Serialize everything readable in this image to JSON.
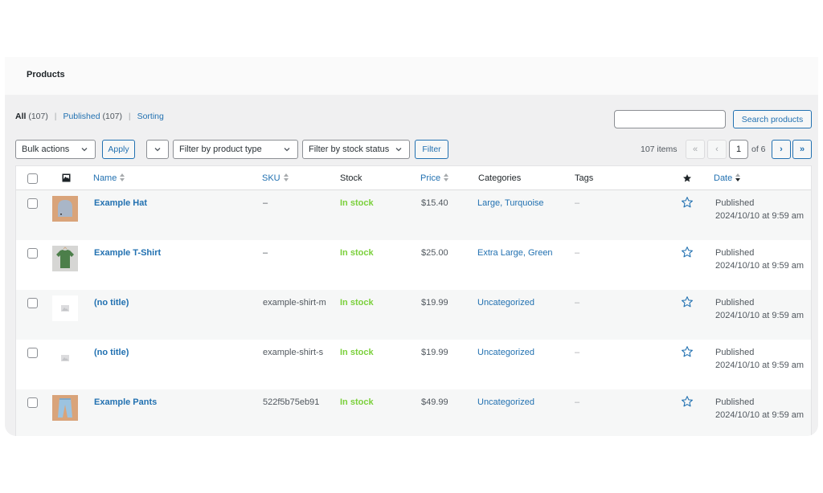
{
  "page": {
    "title": "Products"
  },
  "views": {
    "all_label": "All",
    "all_count": "(107)",
    "published_label": "Published",
    "published_count": "(107)",
    "sorting_label": "Sorting",
    "separator": "|"
  },
  "search": {
    "placeholder": "",
    "value": "",
    "button_label": "Search products"
  },
  "toolbar": {
    "bulk_actions": "Bulk actions",
    "apply_label": "Apply",
    "product_type": "Filter by product type",
    "stock_status": "Filter by stock status",
    "filter_label": "Filter"
  },
  "pagination": {
    "items": "107 items",
    "first": "«",
    "prev": "‹",
    "current": "1",
    "of": "of 6",
    "next": "›",
    "last": "»"
  },
  "table": {
    "columns": {
      "thumb": "image-icon",
      "name": "Name",
      "sku": "SKU",
      "stock": "Stock",
      "price": "Price",
      "categories": "Categories",
      "tags": "Tags",
      "featured": "star-icon",
      "date": "Date"
    },
    "rows": [
      {
        "thumb": "hat",
        "name": "Example Hat",
        "sku": "–",
        "stock": "In stock",
        "price": "$15.40",
        "categories": "Large, Turquoise",
        "tags": "–",
        "status": "Published",
        "date": "2024/10/10 at 9:59 am"
      },
      {
        "thumb": "tshirt",
        "name": "Example T-Shirt",
        "sku": "–",
        "stock": "In stock",
        "price": "$25.00",
        "categories": "Extra Large, Green",
        "tags": "–",
        "status": "Published",
        "date": "2024/10/10 at 9:59 am"
      },
      {
        "thumb": "placeholder",
        "name": "(no title)",
        "sku": "example-shirt-m",
        "stock": "In stock",
        "price": "$19.99",
        "categories": "Uncategorized",
        "tags": "–",
        "status": "Published",
        "date": "2024/10/10 at 9:59 am"
      },
      {
        "thumb": "placeholder",
        "name": "(no title)",
        "sku": "example-shirt-s",
        "stock": "In stock",
        "price": "$19.99",
        "categories": "Uncategorized",
        "tags": "–",
        "status": "Published",
        "date": "2024/10/10 at 9:59 am"
      },
      {
        "thumb": "pants",
        "name": "Example Pants",
        "sku": "522f5b75eb91",
        "stock": "In stock",
        "price": "$49.99",
        "categories": "Uncategorized",
        "tags": "–",
        "status": "Published",
        "date": "2024/10/10 at 9:59 am"
      }
    ]
  },
  "colors": {
    "link": "#2271b1",
    "in_stock": "#7ad03a",
    "background": "#f0f0f1"
  }
}
